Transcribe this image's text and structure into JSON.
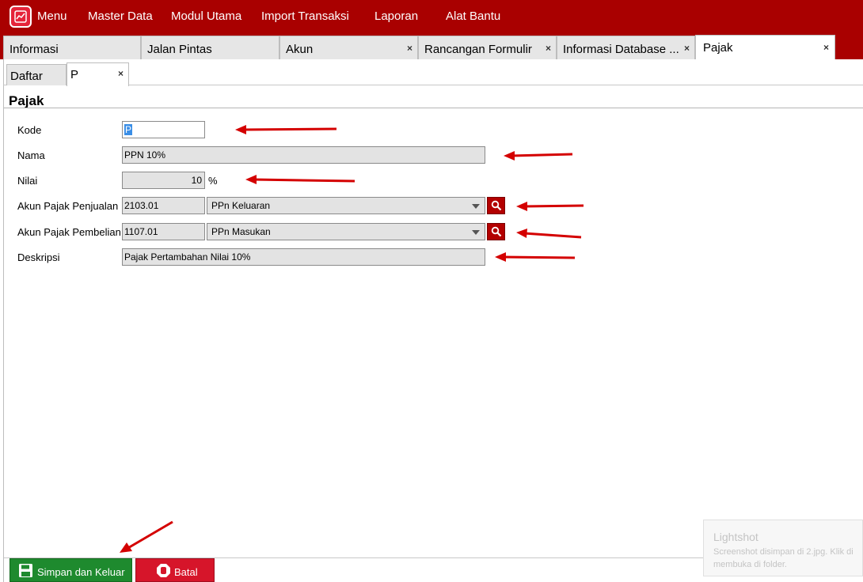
{
  "menubar": {
    "brand_color": "#a90000",
    "logo_icon": "chart-logo-icon",
    "items": [
      "Menu",
      "Master Data",
      "Modul Utama",
      "Import Transaksi",
      "Laporan",
      "Alat Bantu"
    ]
  },
  "tabs": [
    {
      "label": "Informasi",
      "closable": false
    },
    {
      "label": "Jalan Pintas",
      "closable": false
    },
    {
      "label": "Akun",
      "closable": true
    },
    {
      "label": "Rancangan Formulir",
      "closable": true
    },
    {
      "label": "Informasi Database ...",
      "closable": true
    },
    {
      "label": "Pajak",
      "closable": true,
      "active": true
    }
  ],
  "tab_close_glyph": "×",
  "subtabs": [
    {
      "label": "Daftar"
    },
    {
      "label": "P",
      "active": true
    }
  ],
  "form": {
    "title": "Pajak",
    "kode": {
      "label": "Kode",
      "value": "P"
    },
    "nama": {
      "label": "Nama",
      "value": "PPN 10%"
    },
    "nilai": {
      "label": "Nilai",
      "value": "10",
      "unit": "%"
    },
    "akun_penjualan": {
      "label": "Akun Pajak Penjualan",
      "code": "2103.01",
      "name": "PPn Keluaran"
    },
    "akun_pembelian": {
      "label": "Akun Pajak Pembelian",
      "code": "1107.01",
      "name": "PPn Masukan"
    },
    "deskripsi": {
      "label": "Deskripsi",
      "value": "Pajak Pertambahan Nilai 10%"
    }
  },
  "buttons": {
    "save": {
      "label": "Simpan dan Keluar",
      "icon": "floppy-disk-icon",
      "color": "#1e8a2e"
    },
    "cancel": {
      "label": "Batal",
      "icon": "stop-hand-icon",
      "color": "#d6152a"
    }
  },
  "toast": {
    "title": "Lightshot",
    "line1": "Screenshot disimpan di 2.jpg. Klik di",
    "line2": "membuka di folder."
  },
  "annotation_color": "#d40000"
}
